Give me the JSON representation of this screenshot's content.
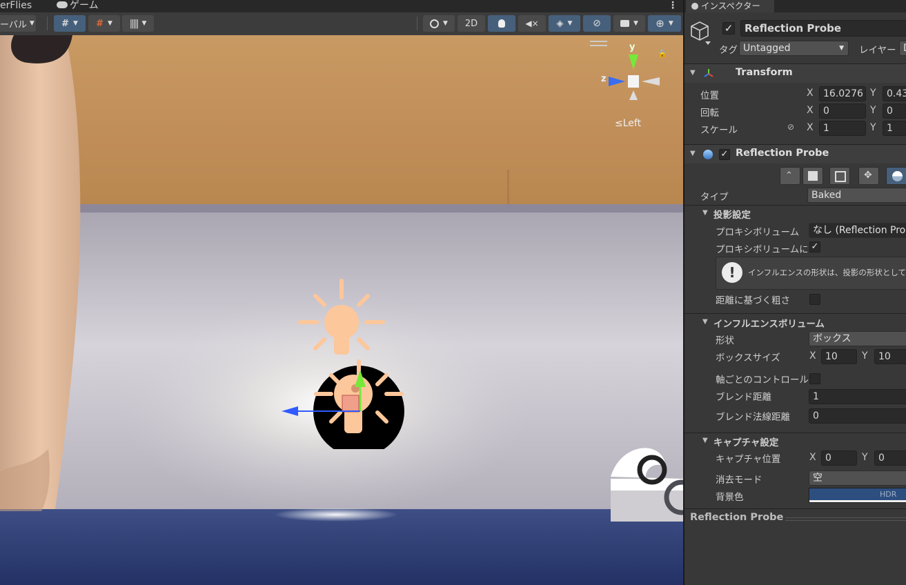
{
  "scene": {
    "tabs": [
      "erFlies",
      "ゲーム"
    ],
    "toolbar": {
      "left_dropdown": "ーバル",
      "mode_2d": "2D"
    },
    "orientation": {
      "y": "y",
      "z": "z",
      "view": "≤Left"
    }
  },
  "inspector": {
    "tab_label": "インスペクター",
    "object": {
      "name": "Reflection Probe",
      "active": true,
      "tag_label": "タグ",
      "tag_value": "Untagged",
      "layer_label": "レイヤー",
      "layer_value": "D"
    },
    "transform": {
      "title": "Transform",
      "position_label": "位置",
      "rotation_label": "回転",
      "scale_label": "スケール",
      "x_axis": "X",
      "y_axis": "Y",
      "position": {
        "x": "16.0276",
        "y": "0.43"
      },
      "rotation": {
        "x": "0",
        "y": "0"
      },
      "scale": {
        "x": "1",
        "y": "1"
      }
    },
    "probe": {
      "title": "Reflection Probe",
      "enabled": true,
      "type_label": "タイプ",
      "type_value": "Baked",
      "projection": {
        "title": "投影設定",
        "proxy_volume_label": "プロキシボリューム",
        "proxy_volume_value": "なし (Reflection Pro",
        "proxy_volume_influence_label": "プロキシボリュームにイン",
        "proxy_volume_influence_checked": true,
        "info_text": "インフルエンスの形状は、投影の形状としても使",
        "distance_roughness_label": "距離に基づく粗さ"
      },
      "influence": {
        "title": "インフルエンスボリューム",
        "shape_label": "形状",
        "shape_value": "ボックス",
        "box_size_label": "ボックスサイズ",
        "box_size": {
          "x": "10",
          "y": "10"
        },
        "per_axis_label": "軸ごとのコントロール",
        "blend_distance_label": "ブレンド距離",
        "blend_distance_value": "1",
        "blend_normal_label": "ブレンド法線距離",
        "blend_normal_value": "0"
      },
      "capture": {
        "title": "キャプチャ設定",
        "position_label": "キャプチャ位置",
        "position": {
          "x": "0",
          "y": "0"
        },
        "clear_mode_label": "消去モード",
        "clear_mode_value": "空",
        "bg_color_label": "背景色",
        "bg_color_badge": "HDR",
        "bg_color": "#2d4f80"
      }
    },
    "footer_title": "Reflection Probe"
  },
  "colors": {
    "accent_blue": "#46607c",
    "panel_bg": "#383838",
    "gizmo_orange": "#fcc79b",
    "axis_green": "#76e83a",
    "axis_blue": "#2f5bff"
  }
}
